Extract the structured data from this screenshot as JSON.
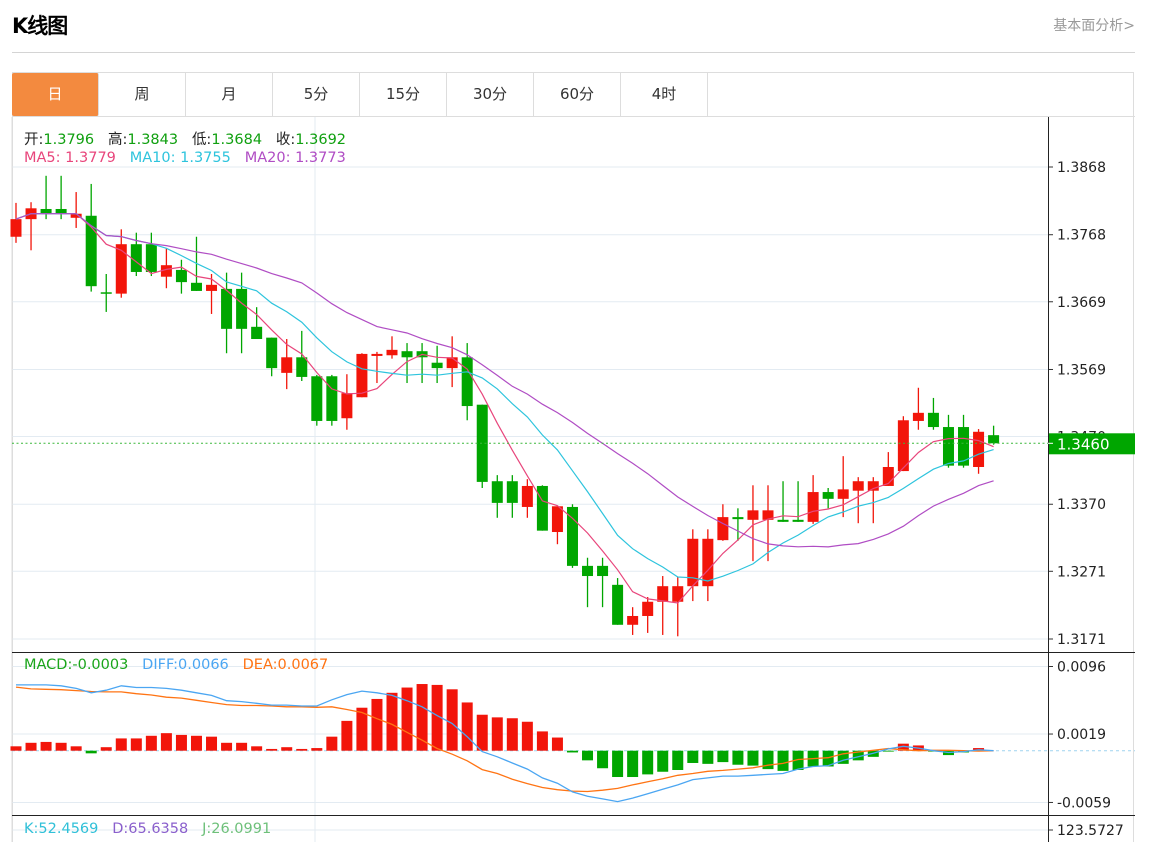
{
  "header": {
    "title": "K线图",
    "link": "基本面分析>"
  },
  "tabs": [
    {
      "label": "日",
      "active": true
    },
    {
      "label": "周"
    },
    {
      "label": "月"
    },
    {
      "label": "5分"
    },
    {
      "label": "15分"
    },
    {
      "label": "30分"
    },
    {
      "label": "60分"
    },
    {
      "label": "4时"
    }
  ],
  "info": {
    "open_label": "开:",
    "open": "1.3796",
    "high_label": "高:",
    "high": "1.3843",
    "low_label": "低:",
    "low": "1.3684",
    "close_label": "收:",
    "close": "1.3692",
    "ma5_label": "MA5:",
    "ma5": "1.3779",
    "ma10_label": "MA10:",
    "ma10": "1.3755",
    "ma20_label": "MA20:",
    "ma20": "1.3773"
  },
  "macd_info": {
    "macd_label": "MACD:",
    "macd": "-0.0003",
    "diff_label": "DIFF:",
    "diff": "0.0066",
    "dea_label": "DEA:",
    "dea": "0.0067"
  },
  "kdj_info": {
    "k_label": "K:",
    "k": "52.4569",
    "d_label": "D:",
    "d": "65.6358",
    "j_label": "J:",
    "j": "26.0991"
  },
  "colors": {
    "up": "#f2150a",
    "down": "#00a600",
    "ma5": "#e8467c",
    "ma10": "#2ec4dd",
    "ma20": "#b04dc4",
    "diff": "#4ba6f2",
    "dea": "#ff7414",
    "accent": "#f38a3f"
  },
  "chart_data": [
    {
      "type": "candlestick",
      "ylim": [
        1.3135,
        1.3935
      ],
      "y_ticks": [
        "1.3868",
        "1.3768",
        "1.3669",
        "1.3569",
        "1.3470",
        "1.3370",
        "1.3271",
        "1.3171"
      ],
      "grid": true,
      "current_price": "1.3460",
      "ma_periods": [
        5,
        10,
        20
      ],
      "ohlc": [
        [
          1.3765,
          1.3815,
          1.3756,
          1.3791
        ],
        [
          1.3791,
          1.3816,
          1.3745,
          1.3807
        ],
        [
          1.3806,
          1.3855,
          1.3791,
          1.3799
        ],
        [
          1.3806,
          1.3855,
          1.3791,
          1.3799
        ],
        [
          1.3793,
          1.3831,
          1.3778,
          1.3799
        ],
        [
          1.3796,
          1.3843,
          1.3684,
          1.3692
        ],
        [
          1.3683,
          1.371,
          1.3654,
          1.3681
        ],
        [
          1.3681,
          1.3776,
          1.3675,
          1.3754
        ],
        [
          1.3754,
          1.3771,
          1.3707,
          1.3713
        ],
        [
          1.3754,
          1.3771,
          1.3707,
          1.3713
        ],
        [
          1.3706,
          1.3748,
          1.3689,
          1.3723
        ],
        [
          1.3716,
          1.3731,
          1.3681,
          1.3698
        ],
        [
          1.3697,
          1.3765,
          1.3685,
          1.3685
        ],
        [
          1.3685,
          1.371,
          1.3651,
          1.3694
        ],
        [
          1.3688,
          1.3712,
          1.3593,
          1.3629
        ],
        [
          1.3688,
          1.3712,
          1.3593,
          1.3629
        ],
        [
          1.3632,
          1.3661,
          1.3614,
          1.3614
        ],
        [
          1.3616,
          1.3616,
          1.3559,
          1.3571
        ],
        [
          1.3564,
          1.3614,
          1.354,
          1.3587
        ],
        [
          1.3587,
          1.3626,
          1.3552,
          1.3558
        ],
        [
          1.3559,
          1.3561,
          1.3486,
          1.3493
        ],
        [
          1.3559,
          1.3561,
          1.3486,
          1.3493
        ],
        [
          1.3497,
          1.3562,
          1.348,
          1.3534
        ],
        [
          1.3528,
          1.3593,
          1.3528,
          1.3592
        ],
        [
          1.3589,
          1.3595,
          1.3549,
          1.3592
        ],
        [
          1.359,
          1.3618,
          1.3585,
          1.3598
        ],
        [
          1.3596,
          1.3608,
          1.3549,
          1.3587
        ],
        [
          1.3596,
          1.3608,
          1.3549,
          1.3587
        ],
        [
          1.3579,
          1.3604,
          1.3549,
          1.3571
        ],
        [
          1.3571,
          1.3618,
          1.3543,
          1.3587
        ],
        [
          1.3587,
          1.3608,
          1.3494,
          1.3515
        ],
        [
          1.3517,
          1.3517,
          1.3394,
          1.3403
        ],
        [
          1.3404,
          1.3413,
          1.335,
          1.3372
        ],
        [
          1.3404,
          1.3413,
          1.335,
          1.3372
        ],
        [
          1.3366,
          1.3407,
          1.335,
          1.3397
        ],
        [
          1.3397,
          1.3398,
          1.3331,
          1.3331
        ],
        [
          1.3329,
          1.3367,
          1.3311,
          1.3367
        ],
        [
          1.3366,
          1.337,
          1.3276,
          1.3279
        ],
        [
          1.3279,
          1.3291,
          1.3218,
          1.3264
        ],
        [
          1.3279,
          1.3291,
          1.3218,
          1.3264
        ],
        [
          1.3251,
          1.3261,
          1.3192,
          1.3192
        ],
        [
          1.3192,
          1.3218,
          1.3177,
          1.3205
        ],
        [
          1.3205,
          1.3233,
          1.318,
          1.3226
        ],
        [
          1.3226,
          1.3264,
          1.3177,
          1.3249
        ],
        [
          1.3226,
          1.3263,
          1.3175,
          1.3249
        ],
        [
          1.3249,
          1.3333,
          1.3227,
          1.3319
        ],
        [
          1.3249,
          1.3333,
          1.3227,
          1.3319
        ],
        [
          1.3317,
          1.337,
          1.3316,
          1.3351
        ],
        [
          1.3351,
          1.3364,
          1.3316,
          1.3348
        ],
        [
          1.3347,
          1.3398,
          1.3286,
          1.3361
        ],
        [
          1.3347,
          1.3398,
          1.3286,
          1.3361
        ],
        [
          1.3347,
          1.3404,
          1.3344,
          1.3344
        ],
        [
          1.3347,
          1.3404,
          1.3344,
          1.3344
        ],
        [
          1.3344,
          1.3413,
          1.3341,
          1.3388
        ],
        [
          1.3388,
          1.3394,
          1.3364,
          1.3378
        ],
        [
          1.3378,
          1.3441,
          1.3351,
          1.3392
        ],
        [
          1.339,
          1.341,
          1.3342,
          1.3404
        ],
        [
          1.339,
          1.341,
          1.3342,
          1.3404
        ],
        [
          1.3397,
          1.3447,
          1.3397,
          1.3425
        ],
        [
          1.3419,
          1.35,
          1.3419,
          1.3494
        ],
        [
          1.3493,
          1.3542,
          1.348,
          1.3505
        ],
        [
          1.3505,
          1.3527,
          1.348,
          1.3484
        ],
        [
          1.3484,
          1.3502,
          1.3424,
          1.3427
        ],
        [
          1.3484,
          1.3502,
          1.3424,
          1.3427
        ],
        [
          1.3425,
          1.3481,
          1.3415,
          1.3477
        ],
        [
          1.3472,
          1.3486,
          1.3458,
          1.346
        ]
      ]
    },
    {
      "type": "bar+line",
      "ylim": [
        -0.0065,
        0.0105
      ],
      "y_ticks": [
        "0.0096",
        "0.0019",
        "-0.0059"
      ],
      "macd": [
        0.0005,
        0.0009,
        0.001,
        0.0009,
        0.0005,
        -0.0003,
        0.0004,
        0.0014,
        0.0014,
        0.0017,
        0.002,
        0.0018,
        0.0017,
        0.0016,
        0.0009,
        0.0009,
        0.0005,
        0.0002,
        0.0004,
        0.0002,
        0.0003,
        0.0016,
        0.0034,
        0.0049,
        0.0059,
        0.0066,
        0.0072,
        0.0076,
        0.0075,
        0.007,
        0.0055,
        0.0041,
        0.0038,
        0.0037,
        0.0033,
        0.0022,
        0.0015,
        -0.0002,
        -0.0011,
        -0.002,
        -0.003,
        -0.003,
        -0.0027,
        -0.0024,
        -0.0022,
        -0.0014,
        -0.0015,
        -0.0013,
        -0.0016,
        -0.0017,
        -0.0021,
        -0.0023,
        -0.0022,
        -0.0018,
        -0.0018,
        -0.0015,
        -0.0011,
        -0.0007,
        -0.0001,
        0.0008,
        0.0006,
        -0.0001,
        -0.0005,
        -0.0002,
        0.0003,
        0.0
      ],
      "diff": [
        0.0075,
        0.0075,
        0.0075,
        0.0074,
        0.0071,
        0.0066,
        0.0069,
        0.0074,
        0.0072,
        0.0072,
        0.0071,
        0.0069,
        0.0066,
        0.0063,
        0.0057,
        0.0056,
        0.0054,
        0.0052,
        0.0052,
        0.0051,
        0.0051,
        0.0058,
        0.0064,
        0.0068,
        0.0066,
        0.0063,
        0.0057,
        0.005,
        0.004,
        0.0031,
        0.0016,
        -0.0001,
        -0.0007,
        -0.0014,
        -0.0021,
        -0.0031,
        -0.0037,
        -0.0047,
        -0.0052,
        -0.0055,
        -0.0058,
        -0.0054,
        -0.0049,
        -0.0044,
        -0.0039,
        -0.0033,
        -0.0031,
        -0.0029,
        -0.0029,
        -0.0028,
        -0.0027,
        -0.0026,
        -0.0021,
        -0.0018,
        -0.0017,
        -0.0011,
        -0.0007,
        -0.0003,
        0.0002,
        0.0005,
        0.0003,
        0.0,
        -0.0002,
        -0.0001,
        0.0001,
        0.0
      ]
    },
    {
      "type": "line",
      "y_ticks": [
        "123.5727"
      ]
    }
  ]
}
